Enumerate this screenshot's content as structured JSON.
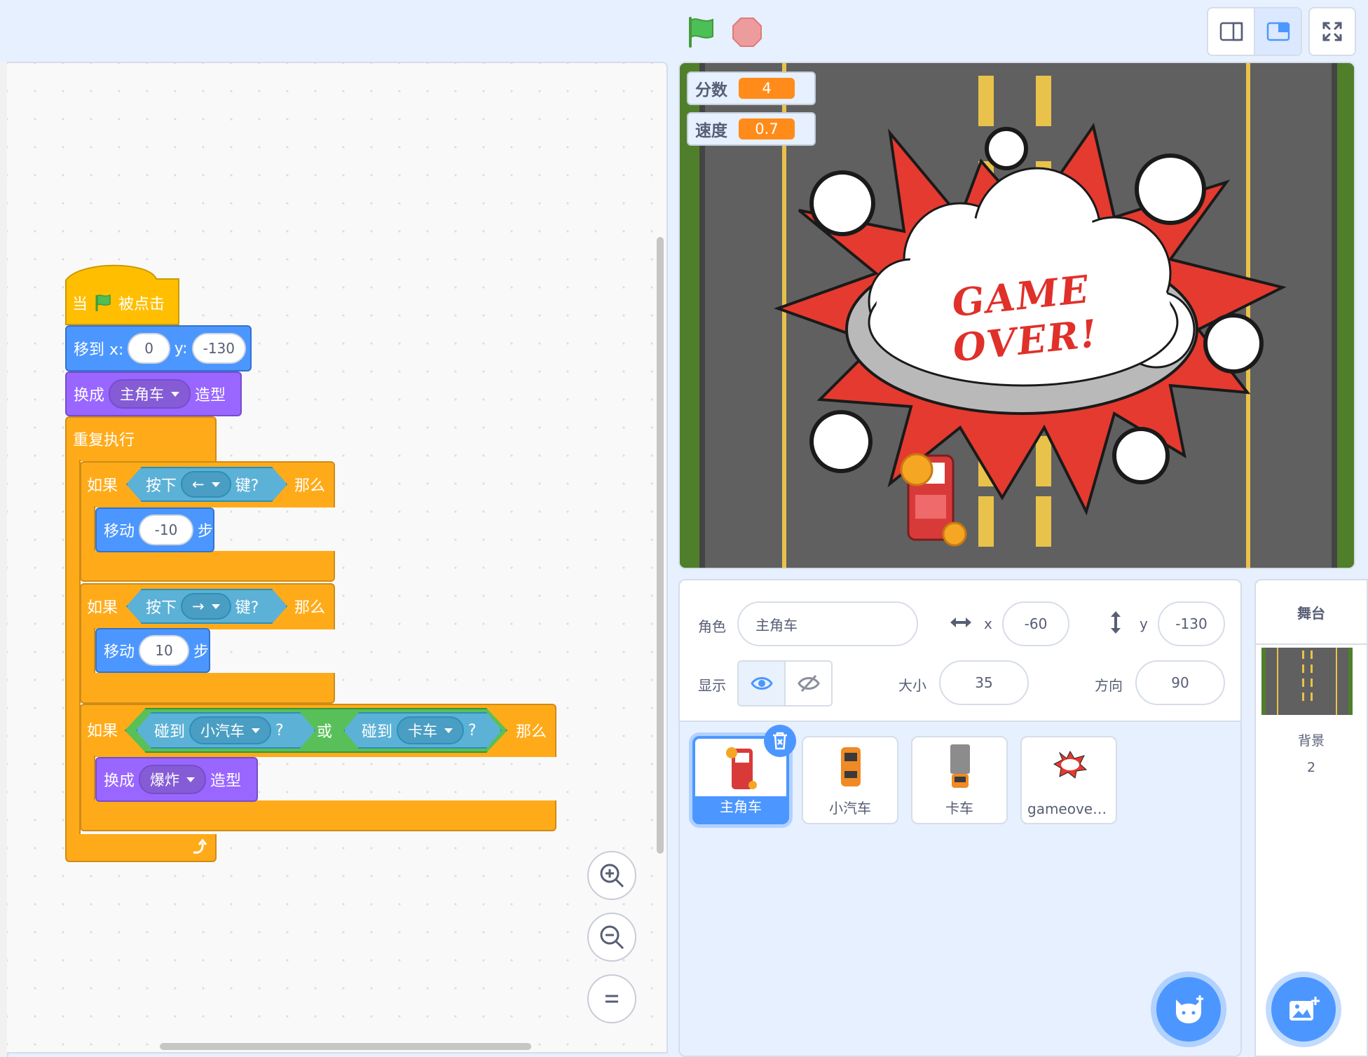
{
  "toolbar": {
    "green_flag": "green-flag-icon",
    "stop": "stop-icon",
    "small_stage_mode": "small-stage-icon",
    "normal_stage_mode": "normal-stage-icon",
    "fullscreen": "fullscreen-icon"
  },
  "script": {
    "hat": {
      "when": "当",
      "clicked": "被点击"
    },
    "goto": {
      "label": "移到 x:",
      "x": "0",
      "ylabel": "y:",
      "y": "-130"
    },
    "switch1": {
      "label": "换成",
      "costume": "主角车",
      "suffix": "造型"
    },
    "forever": "重复执行",
    "if1": {
      "if": "如果",
      "key_pressed": "按下",
      "key": "←",
      "key_suffix": "键?",
      "then": "那么"
    },
    "move1": {
      "label": "移动",
      "steps": "-10",
      "suffix": "步"
    },
    "if2": {
      "if": "如果",
      "key_pressed": "按下",
      "key": "→",
      "key_suffix": "键?",
      "then": "那么"
    },
    "move2": {
      "label": "移动",
      "steps": "10",
      "suffix": "步"
    },
    "if3": {
      "if": "如果",
      "touching": "碰到",
      "target1": "小汽车",
      "q": "?",
      "or": "或",
      "target2": "卡车",
      "then": "那么"
    },
    "switch2": {
      "label": "换成",
      "costume": "爆炸",
      "suffix": "造型"
    }
  },
  "stage": {
    "monitors": [
      {
        "label": "分数",
        "value": "4"
      },
      {
        "label": "速度",
        "value": "0.7"
      }
    ],
    "game_over_text": "GAME OVER!"
  },
  "sprite_info": {
    "sprite_label": "角色",
    "sprite_name": "主角车",
    "x_label": "x",
    "x": "-60",
    "y_label": "y",
    "y": "-130",
    "show_label": "显示",
    "size_label": "大小",
    "size": "35",
    "direction_label": "方向",
    "direction": "90"
  },
  "sprites": [
    {
      "name": "主角车",
      "selected": true
    },
    {
      "name": "小汽车",
      "selected": false
    },
    {
      "name": "卡车",
      "selected": false
    },
    {
      "name": "gameover…",
      "selected": false
    }
  ],
  "stage_pane": {
    "title": "舞台",
    "backdrops_label": "背景",
    "backdrops_count": "2"
  },
  "colors": {
    "motion": "#4c97ff",
    "looks": "#9966ff",
    "events": "#ffbf00",
    "control": "#ffab19",
    "sensing": "#5cb1d6",
    "operators": "#59c059",
    "variable": "#ff8c1a"
  }
}
